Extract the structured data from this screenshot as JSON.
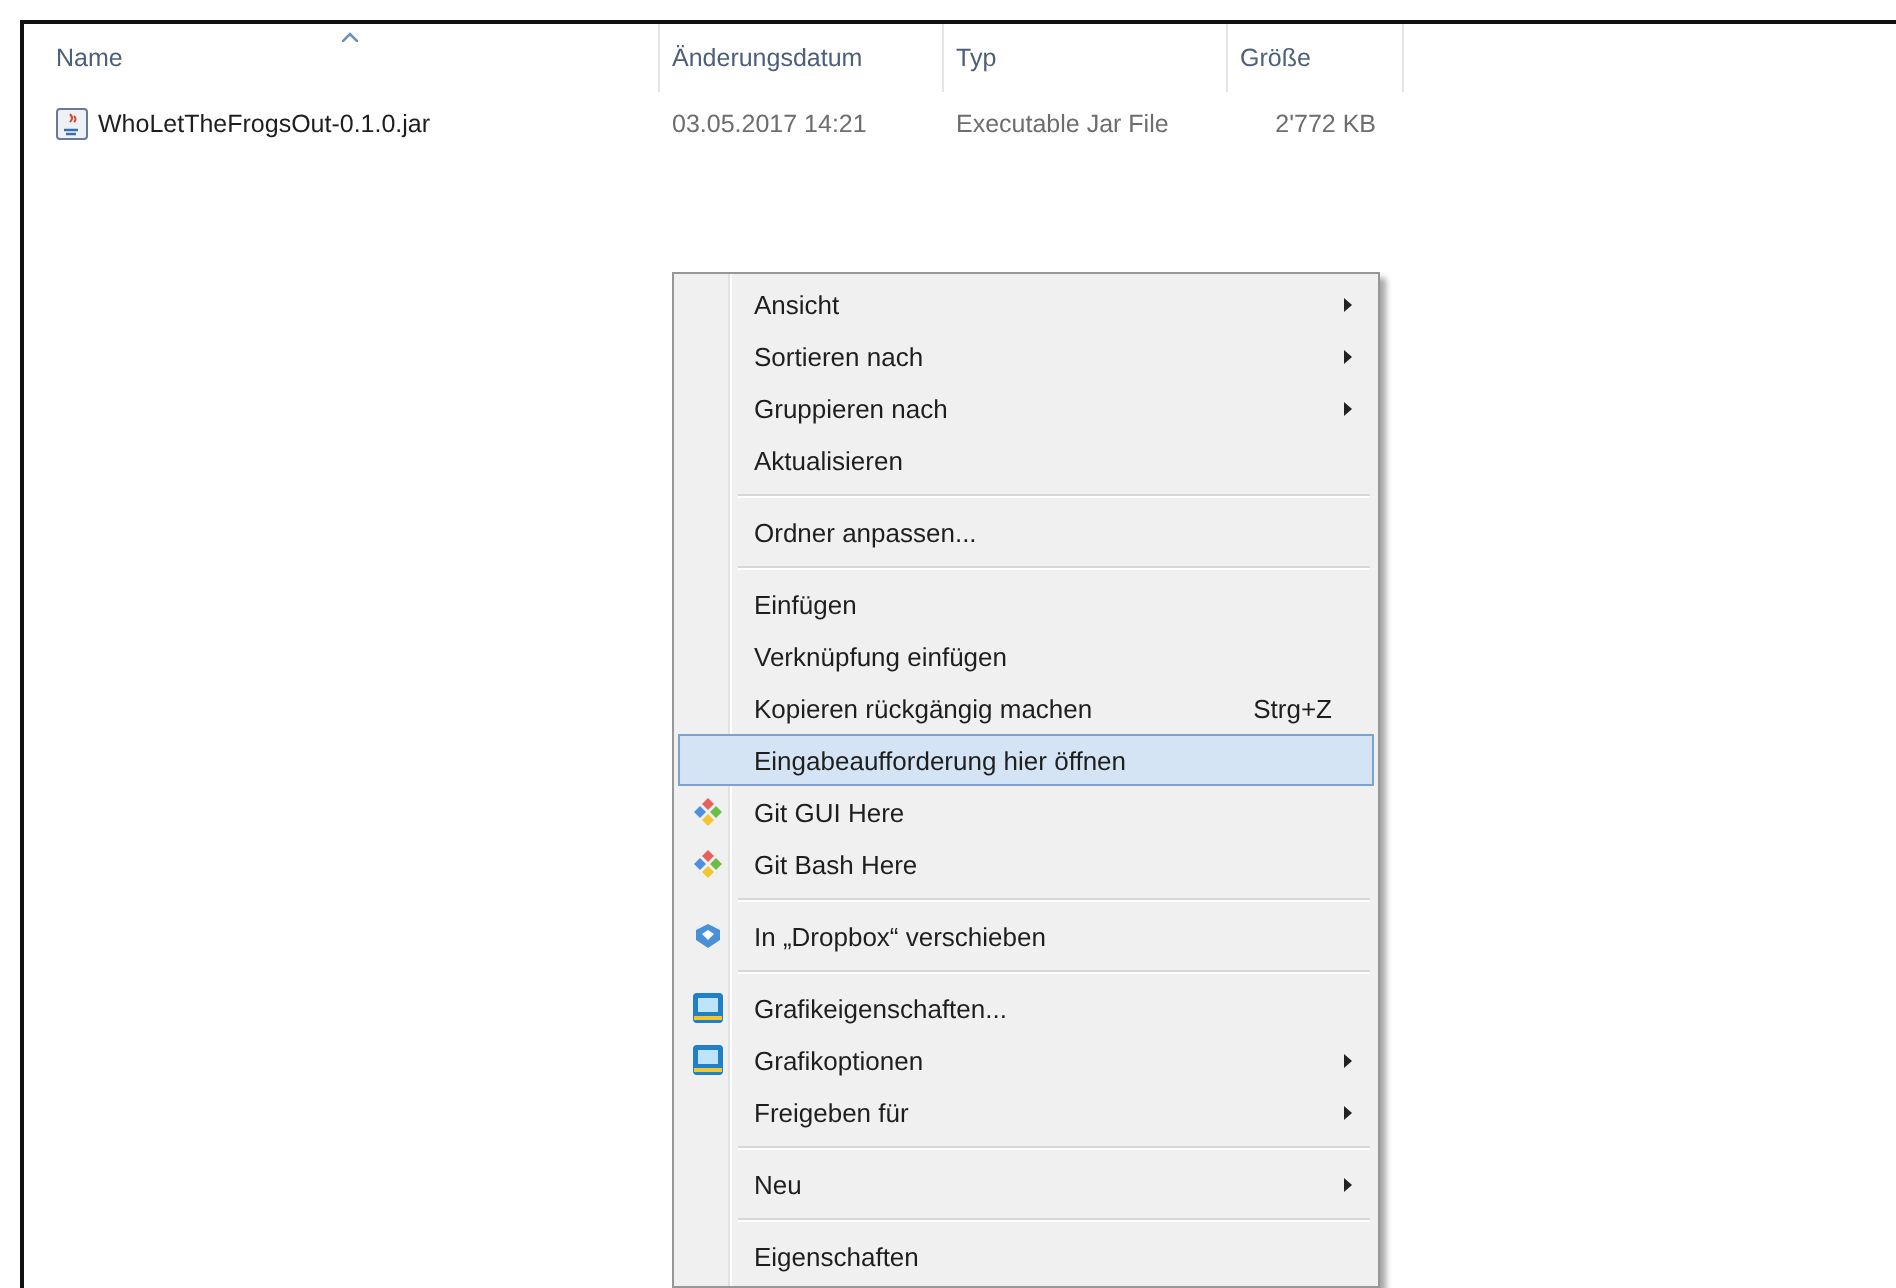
{
  "columns": [
    {
      "label": "Name",
      "sorted": true
    },
    {
      "label": "Änderungsdatum",
      "sorted": false
    },
    {
      "label": "Typ",
      "sorted": false
    },
    {
      "label": "Größe",
      "sorted": false
    }
  ],
  "files": [
    {
      "name": "WhoLetTheFrogsOut-0.1.0.jar",
      "date": "03.05.2017 14:21",
      "type": "Executable Jar File",
      "size": "2'772 KB"
    }
  ],
  "context_menu": [
    {
      "kind": "item",
      "label": "Ansicht",
      "submenu": true,
      "selected": false
    },
    {
      "kind": "item",
      "label": "Sortieren nach",
      "submenu": true,
      "selected": false
    },
    {
      "kind": "item",
      "label": "Gruppieren nach",
      "submenu": true,
      "selected": false
    },
    {
      "kind": "item",
      "label": "Aktualisieren",
      "submenu": false,
      "selected": false
    },
    {
      "kind": "separator"
    },
    {
      "kind": "item",
      "label": "Ordner anpassen...",
      "submenu": false,
      "selected": false
    },
    {
      "kind": "separator"
    },
    {
      "kind": "item",
      "label": "Einfügen",
      "submenu": false,
      "selected": false
    },
    {
      "kind": "item",
      "label": "Verknüpfung einfügen",
      "submenu": false,
      "selected": false
    },
    {
      "kind": "item",
      "label": "Kopieren rückgängig machen",
      "shortcut": "Strg+Z",
      "submenu": false,
      "selected": false
    },
    {
      "kind": "item",
      "label": "Eingabeaufforderung hier öffnen",
      "submenu": false,
      "selected": true
    },
    {
      "kind": "git",
      "label": "Git GUI Here",
      "submenu": false,
      "selected": false
    },
    {
      "kind": "git",
      "label": "Git Bash Here",
      "submenu": false,
      "selected": false
    },
    {
      "kind": "separator"
    },
    {
      "kind": "dropbox",
      "label": "In „Dropbox“ verschieben",
      "submenu": false,
      "selected": false
    },
    {
      "kind": "separator"
    },
    {
      "kind": "graphics",
      "label": "Grafikeigenschaften...",
      "submenu": false,
      "selected": false
    },
    {
      "kind": "graphics",
      "label": "Grafikoptionen",
      "submenu": true,
      "selected": false
    },
    {
      "kind": "item",
      "label": "Freigeben für",
      "submenu": true,
      "selected": false
    },
    {
      "kind": "separator"
    },
    {
      "kind": "item",
      "label": "Neu",
      "submenu": true,
      "selected": false
    },
    {
      "kind": "separator"
    },
    {
      "kind": "item",
      "label": "Eigenschaften",
      "submenu": false,
      "selected": false
    }
  ]
}
